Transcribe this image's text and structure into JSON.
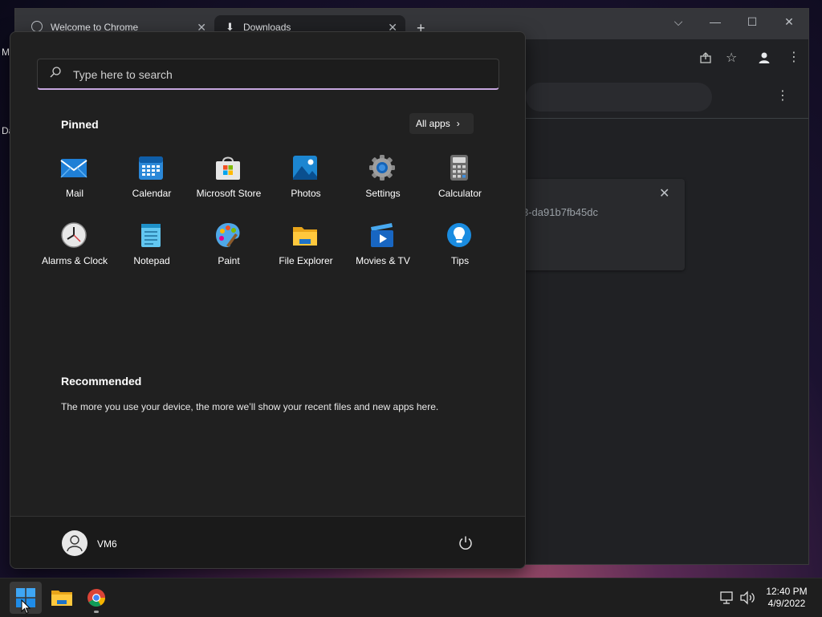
{
  "desktop": {
    "label_m": "M",
    "label_da": "Da"
  },
  "chrome": {
    "tabs": [
      {
        "title": "Welcome to Chrome",
        "close": "✕"
      },
      {
        "title": "Downloads",
        "close": "✕"
      }
    ],
    "new_tab": "+",
    "window_controls": {
      "dropdown": "⌵",
      "minimize": "—",
      "maximize": "☐",
      "close": "✕"
    },
    "downloads": {
      "item_hash": "3-da91b7fb45dc",
      "item_close": "✕",
      "more_menu": "⋮"
    }
  },
  "start_menu": {
    "search": {
      "placeholder": "Type here to search",
      "value": ""
    },
    "pinned": {
      "title": "Pinned",
      "all_apps_label": "All apps",
      "all_apps_chevron": "›",
      "apps": [
        {
          "label": "Mail",
          "icon": "mail-icon"
        },
        {
          "label": "Calendar",
          "icon": "calendar-icon"
        },
        {
          "label": "Microsoft Store",
          "icon": "store-icon"
        },
        {
          "label": "Photos",
          "icon": "photos-icon"
        },
        {
          "label": "Settings",
          "icon": "gear-icon"
        },
        {
          "label": "Calculator",
          "icon": "calculator-icon"
        },
        {
          "label": "Alarms & Clock",
          "icon": "clock-icon"
        },
        {
          "label": "Notepad",
          "icon": "notepad-icon"
        },
        {
          "label": "Paint",
          "icon": "paint-icon"
        },
        {
          "label": "File Explorer",
          "icon": "folder-icon"
        },
        {
          "label": "Movies & TV",
          "icon": "movies-icon"
        },
        {
          "label": "Tips",
          "icon": "tips-icon"
        }
      ]
    },
    "recommended": {
      "title": "Recommended",
      "empty_text": "The more you use your device, the more we’ll show your recent files and new apps here."
    },
    "user": {
      "name": "VM6"
    }
  },
  "taskbar": {
    "clock": {
      "time": "12:40 PM",
      "date": "4/9/2022"
    }
  },
  "colors": {
    "start_bg": "#202020",
    "search_accent": "#c6a7df",
    "taskbar_bg": "#1e1e1e",
    "chrome_bg": "#202124"
  }
}
